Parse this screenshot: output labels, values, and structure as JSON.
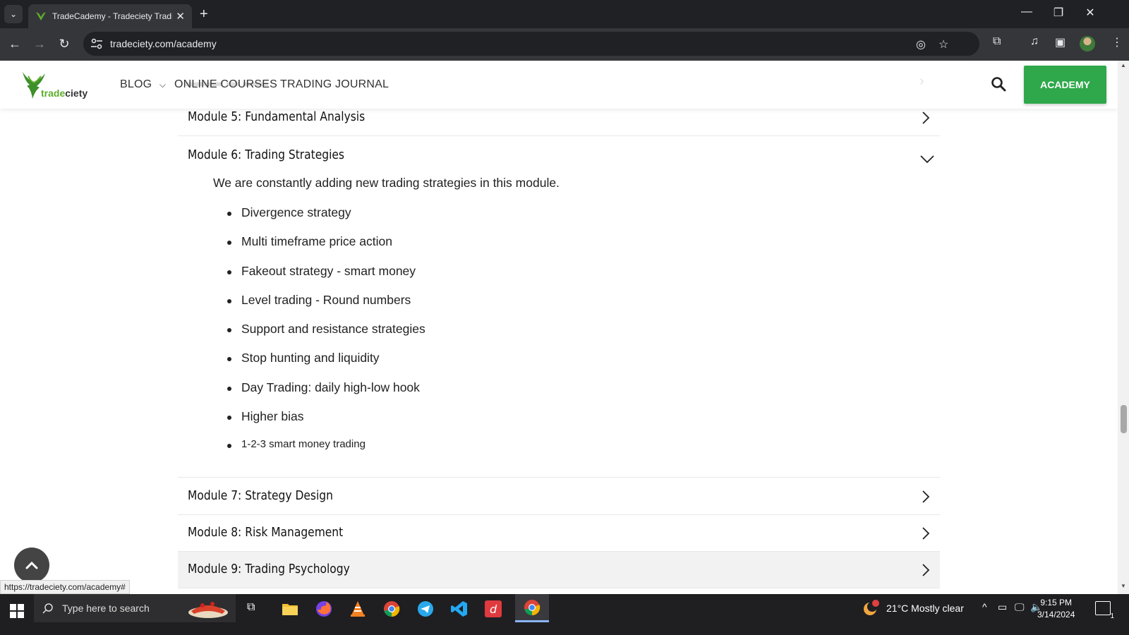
{
  "browser": {
    "tab_title": "TradeCademy - Tradeciety Tradi",
    "url": "tradeciety.com/academy",
    "status_url": "https://tradeciety.com/academy#"
  },
  "site": {
    "logo_text_green": "trade",
    "logo_text_dark": "ciety",
    "nav": {
      "blog": "BLOG",
      "online_courses": "ONLINE COURSES",
      "trading_journal": "TRADING JOURNAL"
    },
    "academy_button": "ACADEMY"
  },
  "accordion": {
    "module5": "Module 5: Fundamental Analysis",
    "module6": "Module 6: Trading Strategies",
    "module6_intro": "We are constantly adding new trading strategies in this module.",
    "strategies": [
      "Divergence strategy",
      "Multi timeframe price action",
      "Fakeout strategy - smart money",
      "Level trading - Round numbers",
      "Support and resistance strategies",
      "Stop hunting and liquidity",
      "Day Trading: daily high-low hook",
      "Higher bias",
      "1-2-3 smart money trading"
    ],
    "module7": "Module 7: Strategy Design",
    "module8": "Module 8: Risk Management",
    "module9": "Module 9: Trading Psychology"
  },
  "taskbar": {
    "search_placeholder": "Type here to search",
    "weather": "21°C  Mostly clear",
    "time": "9:15 PM",
    "date": "3/14/2024",
    "notification_count": "1"
  },
  "colors": {
    "accent_green": "#2ea84a",
    "chrome_dark": "#202124",
    "chrome_toolbar": "#35363a"
  }
}
